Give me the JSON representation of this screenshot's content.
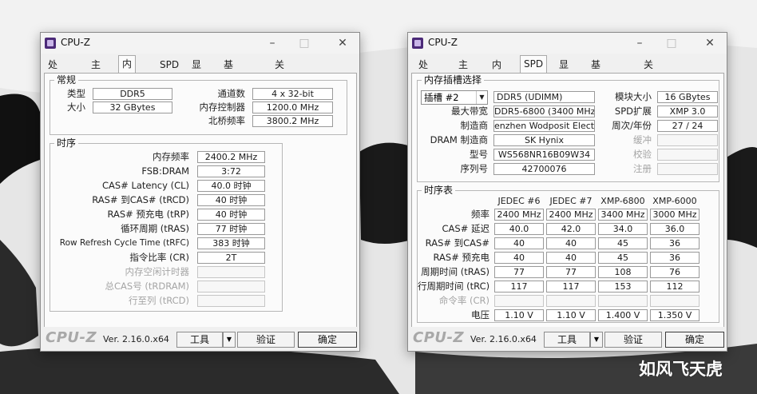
{
  "watermark": "如风飞天虎",
  "colors": {
    "window_bg": "#f0f0f0",
    "pane_bg": "#fbfbfb",
    "logo_gray": "#a8a8a8"
  },
  "left_window": {
    "title": "CPU-Z",
    "tabs": [
      "处理器",
      "主板",
      "内存",
      "SPD",
      "显卡",
      "基准跑分",
      "关于"
    ],
    "active_tab": "内存",
    "general": {
      "title": "常规",
      "type_label": "类型",
      "type_value": "DDR5",
      "size_label": "大小",
      "size_value": "32 GBytes",
      "channels_label": "通道数",
      "channels_value": "4 x 32-bit",
      "mc_label": "内存控制器",
      "mc_value": "1200.0 MHz",
      "nb_label": "北桥频率",
      "nb_value": "3800.2 MHz"
    },
    "timings": {
      "title": "时序",
      "rows": [
        {
          "label": "内存频率",
          "value": "2400.2 MHz",
          "disabled": false
        },
        {
          "label": "FSB:DRAM",
          "value": "3:72",
          "disabled": false
        },
        {
          "label": "CAS# Latency (CL)",
          "value": "40.0 时钟",
          "disabled": false
        },
        {
          "label": "RAS# 到CAS# (tRCD)",
          "value": "40 时钟",
          "disabled": false
        },
        {
          "label": "RAS# 预充电 (tRP)",
          "value": "40 时钟",
          "disabled": false
        },
        {
          "label": "循环周期 (tRAS)",
          "value": "77 时钟",
          "disabled": false
        },
        {
          "label": "Row Refresh Cycle Time (tRFC)",
          "value": "383 时钟",
          "disabled": false
        },
        {
          "label": "指令比率 (CR)",
          "value": "2T",
          "disabled": false
        },
        {
          "label": "内存空闲计时器",
          "value": "",
          "disabled": true
        },
        {
          "label": "总CAS号 (tRDRAM)",
          "value": "",
          "disabled": true
        },
        {
          "label": "行至列 (tRCD)",
          "value": "",
          "disabled": true
        }
      ]
    },
    "bottom": {
      "logo": "CPU-Z",
      "version": "Ver. 2.16.0.x64",
      "tools": "工具",
      "validate": "验证",
      "ok": "确定"
    }
  },
  "right_window": {
    "title": "CPU-Z",
    "tabs": [
      "处理器",
      "主板",
      "内存",
      "SPD",
      "显卡",
      "基准跑分",
      "关于"
    ],
    "active_tab": "SPD",
    "slot": {
      "title": "内存插槽选择",
      "slot_select": "插槽 #2",
      "type_value": "DDR5 (UDIMM)",
      "module_size_label": "模块大小",
      "module_size_value": "16 GBytes",
      "max_bw_label": "最大带宽",
      "max_bw_value": "DDR5-6800 (3400 MHz)",
      "spd_ext_label": "SPD扩展",
      "spd_ext_value": "XMP 3.0",
      "mfr_label": "制造商",
      "mfr_value": "enzhen Wodposit Electroni",
      "week_year_label": "周次/年份",
      "week_year_value": "27 / 24",
      "dram_mfr_label": "DRAM 制造商",
      "dram_mfr_value": "SK Hynix",
      "buffered_label": "缓冲",
      "part_label": "型号",
      "part_value": "WS568NR16B09W34",
      "check_label": "校验",
      "serial_label": "序列号",
      "serial_value": "42700076",
      "reg_label": "注册"
    },
    "timing_table": {
      "title": "时序表",
      "columns": [
        "JEDEC #6",
        "JEDEC #7",
        "XMP-6800",
        "XMP-6000"
      ],
      "rows": [
        {
          "label": "频率",
          "values": [
            "2400 MHz",
            "2400 MHz",
            "3400 MHz",
            "3000 MHz"
          ],
          "disabled": false
        },
        {
          "label": "CAS# 延迟",
          "values": [
            "40.0",
            "42.0",
            "34.0",
            "36.0"
          ],
          "disabled": false
        },
        {
          "label": "RAS# 到CAS#",
          "values": [
            "40",
            "40",
            "45",
            "36"
          ],
          "disabled": false
        },
        {
          "label": "RAS# 预充电",
          "values": [
            "40",
            "40",
            "45",
            "36"
          ],
          "disabled": false
        },
        {
          "label": "周期时间 (tRAS)",
          "values": [
            "77",
            "77",
            "108",
            "76"
          ],
          "disabled": false
        },
        {
          "label": "行周期时间 (tRC)",
          "values": [
            "117",
            "117",
            "153",
            "112"
          ],
          "disabled": false
        },
        {
          "label": "命令率 (CR)",
          "values": [
            "",
            "",
            "",
            ""
          ],
          "disabled": true
        },
        {
          "label": "电压",
          "values": [
            "1.10 V",
            "1.10 V",
            "1.400 V",
            "1.350 V"
          ],
          "disabled": false
        }
      ]
    },
    "bottom": {
      "logo": "CPU-Z",
      "version": "Ver. 2.16.0.x64",
      "tools": "工具",
      "validate": "验证",
      "ok": "确定"
    }
  }
}
